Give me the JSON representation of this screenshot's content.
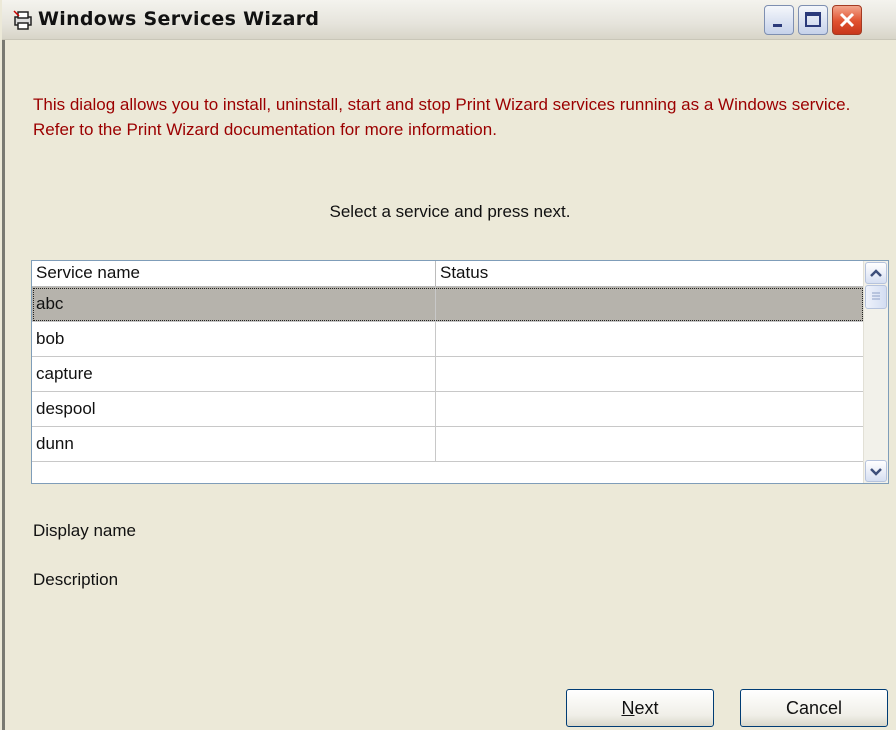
{
  "window": {
    "title": "Windows Services Wizard",
    "controls": [
      "minimize",
      "maximize",
      "close"
    ]
  },
  "intro_text": "This dialog allows you to install, uninstall, start and stop Print Wizard services running as a Windows service. Refer to the Print Wizard documentation for more information.",
  "prompt": "Select a service and press next.",
  "services_table": {
    "columns": [
      "Service name",
      "Status"
    ],
    "rows": [
      {
        "name": "abc",
        "status": "",
        "selected": true
      },
      {
        "name": "bob",
        "status": ""
      },
      {
        "name": "capture",
        "status": ""
      },
      {
        "name": "despool",
        "status": ""
      },
      {
        "name": "dunn",
        "status": ""
      }
    ]
  },
  "fields": {
    "display_name_label": "Display name",
    "description_label": "Description"
  },
  "buttons": {
    "next_first": "N",
    "next_rest": "ext",
    "cancel": "Cancel"
  },
  "colors": {
    "intro_text": "#9b0000",
    "selected_row": "#b6b3ac",
    "background": "#ece9d8"
  }
}
